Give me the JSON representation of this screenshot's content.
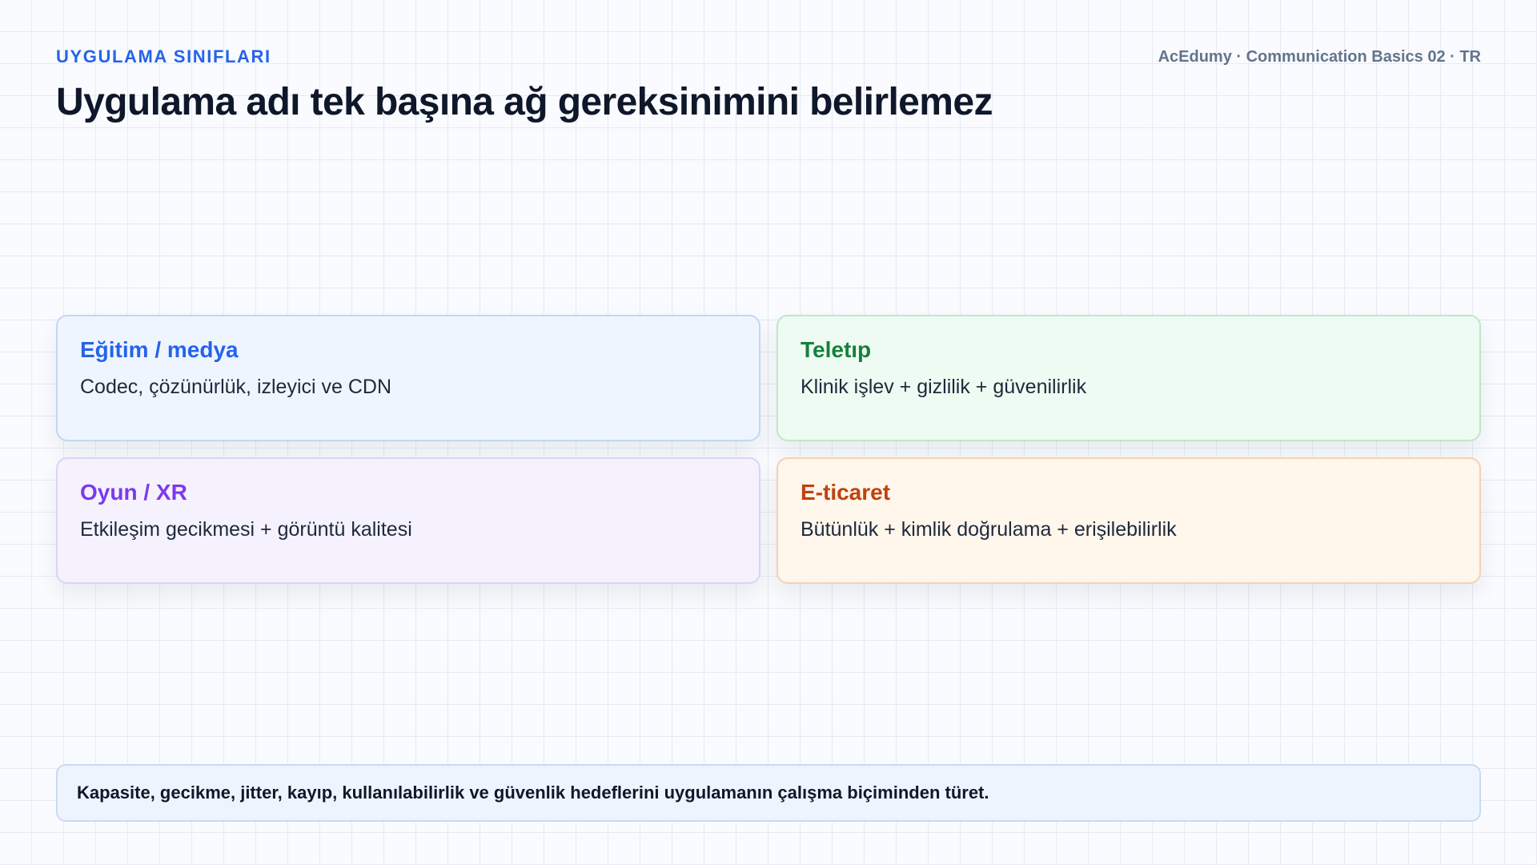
{
  "header": {
    "kicker": "UYGULAMA SINIFLARI",
    "title": "Uygulama adı tek başına ağ gereksinimini belirlemez",
    "brand": "AcEdumy · Communication Basics 02 · TR"
  },
  "cards": [
    {
      "title": "Eğitim / medya",
      "text": "Codec, çözünürlük, izleyici ve CDN",
      "accent": "#2563eb"
    },
    {
      "title": "Teletıp",
      "text": "Klinik işlev + gizlilik + güvenilirlik",
      "accent": "#15803d"
    },
    {
      "title": "Oyun / XR",
      "text": "Etkileşim gecikmesi + görüntü kalitesi",
      "accent": "#7c3aed"
    },
    {
      "title": "E-ticaret",
      "text": "Bütünlük + kimlik doğrulama + erişilebilirlik",
      "accent": "#c2410c"
    }
  ],
  "footer": {
    "text": "Kapasite, gecikme, jitter, kayıp, kullanılabilirlik ve güvenlik hedeflerini uygulamanın çalışma biçiminden türet."
  }
}
